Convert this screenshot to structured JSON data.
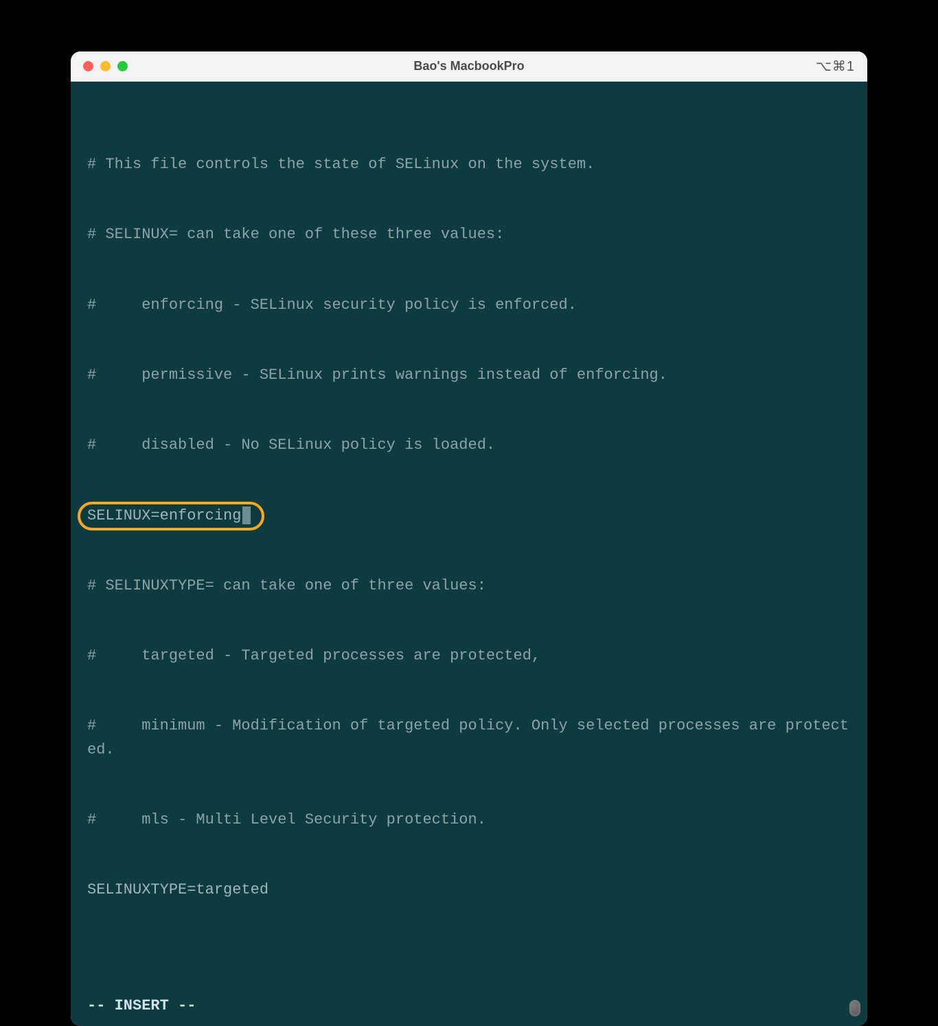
{
  "window": {
    "title": "Bao's MacbookPro",
    "shortcut": "⌥⌘1"
  },
  "editor": {
    "mode_line": "-- INSERT --",
    "highlighted_line": "SELINUX=enforcing",
    "lines": [
      "# This file controls the state of SELinux on the system.",
      "# SELINUX= can take one of these three values:",
      "#     enforcing - SELinux security policy is enforced.",
      "#     permissive - SELinux prints warnings instead of enforcing.",
      "#     disabled - No SELinux policy is loaded.",
      "SELINUX=enforcing",
      "# SELINUXTYPE= can take one of three values:",
      "#     targeted - Targeted processes are protected,",
      "#     minimum - Modification of targeted policy. Only selected processes are protected.",
      "#     mls - Multi Level Security protection.",
      "SELINUXTYPE=targeted"
    ],
    "l0": "# This file controls the state of SELinux on the system.",
    "l1": "# SELINUX= can take one of these three values:",
    "l2": "#     enforcing - SELinux security policy is enforced.",
    "l3": "#     permissive - SELinux prints warnings instead of enforcing.",
    "l4": "#     disabled - No SELinux policy is loaded.",
    "l5": "SELINUX=enforcing",
    "l6": "# SELINUXTYPE= can take one of three values:",
    "l7": "#     targeted - Targeted processes are protected,",
    "l8": "#     minimum - Modification of targeted policy. Only selected processes are protected.",
    "l9": "#     mls - Multi Level Security protection.",
    "l10": "SELINUXTYPE=targeted"
  }
}
